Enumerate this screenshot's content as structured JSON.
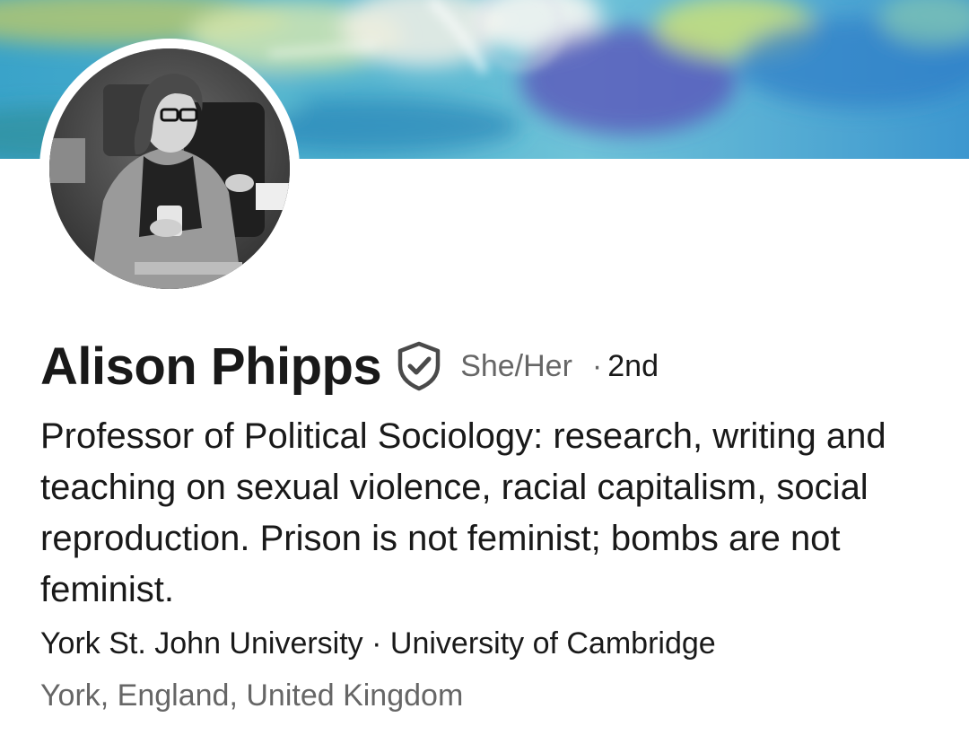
{
  "profile": {
    "name": "Alison Phipps",
    "pronouns": "She/Her",
    "connection_separator": "·",
    "connection_degree": "2nd",
    "headline": "Professor of Political Sociology: research, writing and teaching on sexual violence, racial capitalism, social reproduction. Prison is not feminist; bombs are not feminist.",
    "organizations": "York St. John University · University of Cambridge",
    "location": "York, England, United Kingdom"
  },
  "icons": {
    "verified": "shield-check-icon"
  },
  "colors": {
    "text_primary": "#191919",
    "text_secondary": "#666666",
    "background": "#ffffff"
  }
}
